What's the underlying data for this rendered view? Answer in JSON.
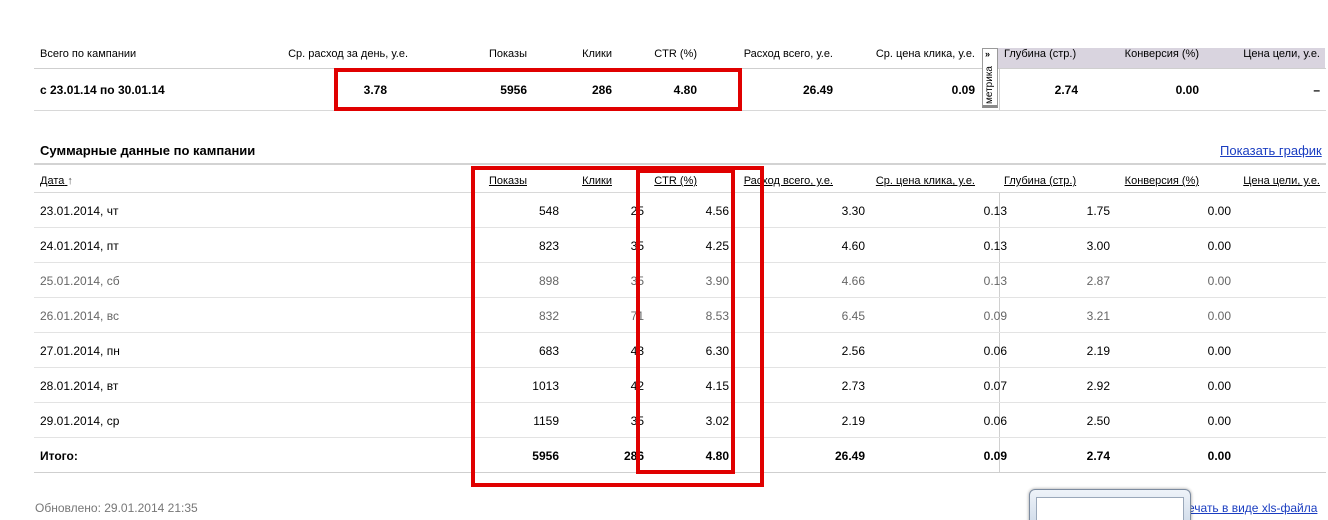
{
  "top": {
    "headers": {
      "campaign": "Всего по кампании",
      "avg_spend": "Ср. расход за день, у.е.",
      "shows": "Показы",
      "clicks": "Клики",
      "ctr": "CTR (%)",
      "spend_total": "Расход всего, у.е.",
      "avg_click": "Ср. цена клика, у.е.",
      "depth": "Глубина (стр.)",
      "conversion": "Конверсия (%)",
      "goal_price": "Цена цели, у.е."
    },
    "row": {
      "period": "с 23.01.14 по 30.01.14",
      "avg_spend": "3.78",
      "shows": "5956",
      "clicks": "286",
      "ctr": "4.80",
      "spend_total": "26.49",
      "avg_click": "0.09",
      "depth": "2.74",
      "conversion": "0.00",
      "goal_price": "–"
    },
    "metrika_tab": {
      "label": "метрика",
      "arrow": "»"
    }
  },
  "section": {
    "title": "Суммарные данные по кампании",
    "show_graph": "Показать график"
  },
  "table": {
    "headers": {
      "date": "Дата",
      "sort_icon": "↑",
      "shows": "Показы",
      "clicks": "Клики",
      "ctr": "CTR (%)",
      "spend_total": "Расход всего, у.е.",
      "avg_click": "Ср. цена клика, у.е.",
      "depth": "Глубина (стр.)",
      "conversion": "Конверсия (%)",
      "goal_price": "Цена цели, у.е."
    },
    "rows": [
      {
        "date": "23.01.2014, чт",
        "shows": "548",
        "clicks": "25",
        "ctr": "4.56",
        "spend": "3.30",
        "avg_click": "0.13",
        "depth": "1.75",
        "conversion": "0.00",
        "goal": "–"
      },
      {
        "date": "24.01.2014, пт",
        "shows": "823",
        "clicks": "35",
        "ctr": "4.25",
        "spend": "4.60",
        "avg_click": "0.13",
        "depth": "3.00",
        "conversion": "0.00",
        "goal": "–"
      },
      {
        "date": "25.01.2014, сб",
        "shows": "898",
        "clicks": "35",
        "ctr": "3.90",
        "spend": "4.66",
        "avg_click": "0.13",
        "depth": "2.87",
        "conversion": "0.00",
        "goal": "–"
      },
      {
        "date": "26.01.2014, вс",
        "shows": "832",
        "clicks": "71",
        "ctr": "8.53",
        "spend": "6.45",
        "avg_click": "0.09",
        "depth": "3.21",
        "conversion": "0.00",
        "goal": "–"
      },
      {
        "date": "27.01.2014, пн",
        "shows": "683",
        "clicks": "43",
        "ctr": "6.30",
        "spend": "2.56",
        "avg_click": "0.06",
        "depth": "2.19",
        "conversion": "0.00",
        "goal": "–"
      },
      {
        "date": "28.01.2014, вт",
        "shows": "1013",
        "clicks": "42",
        "ctr": "4.15",
        "spend": "2.73",
        "avg_click": "0.07",
        "depth": "2.92",
        "conversion": "0.00",
        "goal": "–"
      },
      {
        "date": "29.01.2014, ср",
        "shows": "1159",
        "clicks": "35",
        "ctr": "3.02",
        "spend": "2.19",
        "avg_click": "0.06",
        "depth": "2.50",
        "conversion": "0.00",
        "goal": "–"
      }
    ],
    "total": {
      "label": "Итого:",
      "shows": "5956",
      "clicks": "286",
      "ctr": "4.80",
      "spend": "26.49",
      "avg_click": "0.09",
      "depth": "2.74",
      "conversion": "0.00",
      "goal": "–"
    }
  },
  "footer": {
    "updated": "Обновлено: 29.01.2014 21:35",
    "xls_link": "ечать в виде xls-файла"
  },
  "colors": {
    "highlight": "#e00000",
    "link": "#1a3dc1",
    "metrika_shade": "#d9d4df"
  }
}
